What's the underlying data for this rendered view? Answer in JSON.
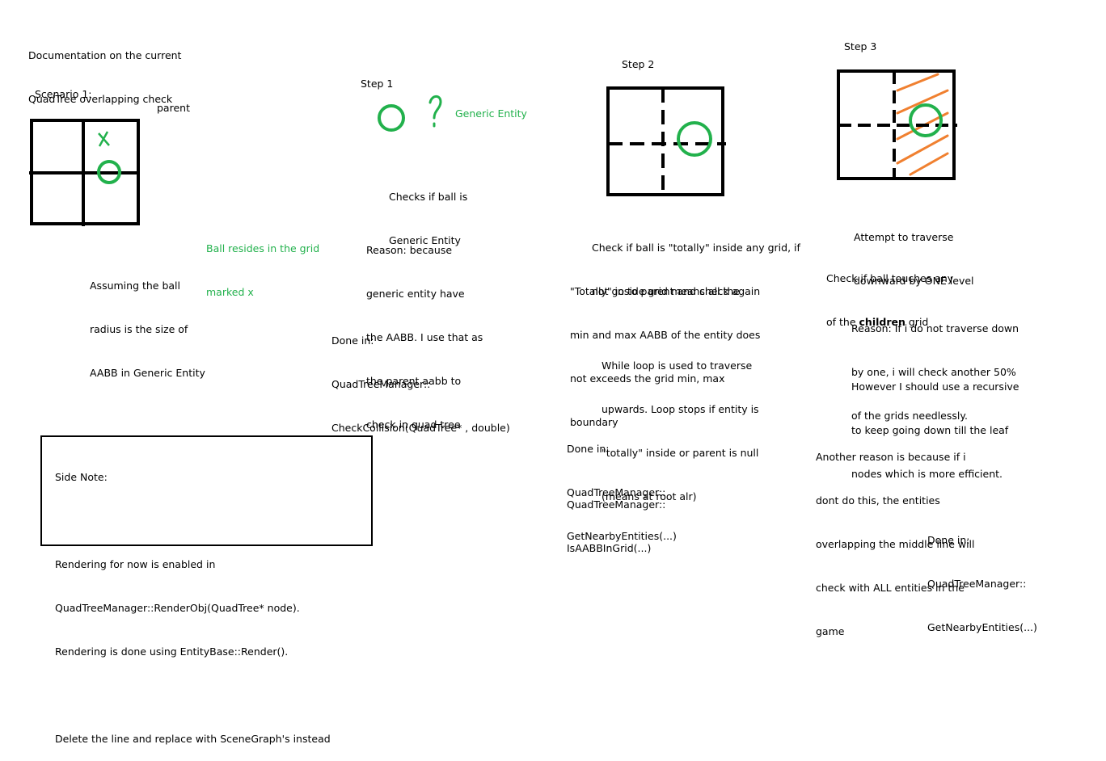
{
  "title": [
    "Documentation on the current",
    "QuadTree overlapping check"
  ],
  "scenario": {
    "heading": "Scenario 1:",
    "parent_label": "parent",
    "x_mark": "x",
    "grid_note": [
      "Ball resides in the grid",
      "marked x"
    ],
    "assumption": [
      "Assuming the ball",
      "radius is the size of",
      "AABB in Generic Entity"
    ]
  },
  "step1": {
    "heading": "Step 1",
    "question_mark": "?",
    "entity_label": "Generic Entity",
    "check": [
      "Checks if ball is",
      "Generic Entity"
    ],
    "reason": [
      "Reason: because",
      "generic entity have",
      "the AABB. I use that as",
      "the parent aabb to",
      "check in quad tree"
    ],
    "done_in": [
      "Done in:",
      "QuadTreeManager::",
      "CheckCollision(QuadTree* , double)"
    ]
  },
  "step2": {
    "heading": "Step 2",
    "check": [
      "Check if ball is \"totally\" inside any grid, if",
      "not go to parent and check again"
    ],
    "totally": [
      "\"Totally\" inside grid means all the",
      "min and max AABB of the entity does",
      "not exceeds the grid min, max",
      "boundary"
    ],
    "loop": [
      "While loop is used to traverse",
      "upwards. Loop stops if entity is",
      "\"totally\" inside or parent is null",
      "(means at root alr)"
    ],
    "done_in": [
      "Done in:",
      "QuadTreeManager::",
      "GetNearbyEntities(...)"
    ],
    "done_in_2": [
      "QuadTreeManager::",
      "IsAABBInGrid(...)"
    ]
  },
  "step3": {
    "heading": "Step 3",
    "attempt": [
      "Attempt to traverse",
      "downward by ONE level"
    ],
    "touch_prefix": "Check if ball touches any",
    "touch_line2_prefix": "of the ",
    "touch_bold": "children",
    "touch_suffix": " grid",
    "reason": [
      "Reason: If i do not traverse down",
      "by one, i will check another 50%",
      "of the grids needlessly."
    ],
    "however": [
      "However I should use a recursive",
      "to keep going down till the leaf",
      "nodes which is more efficient."
    ],
    "another": [
      "Another reason is because if i",
      "dont do this, the entities",
      "overlapping the middle line will",
      "check with ALL entities in the",
      "game"
    ],
    "done_in": [
      "Done in:",
      "QuadTreeManager::",
      "GetNearbyEntities(...)"
    ]
  },
  "side_note": {
    "heading": "Side Note:",
    "lines": [
      "Rendering for now is enabled in",
      "QuadTreeManager::RenderObj(QuadTree* node).",
      "Rendering is done using EntityBase::Render().",
      "",
      "Delete the line and replace with SceneGraph's instead"
    ]
  },
  "colors": {
    "ink": "#000000",
    "ball": "#22b14c",
    "hatch": "#f08030"
  }
}
